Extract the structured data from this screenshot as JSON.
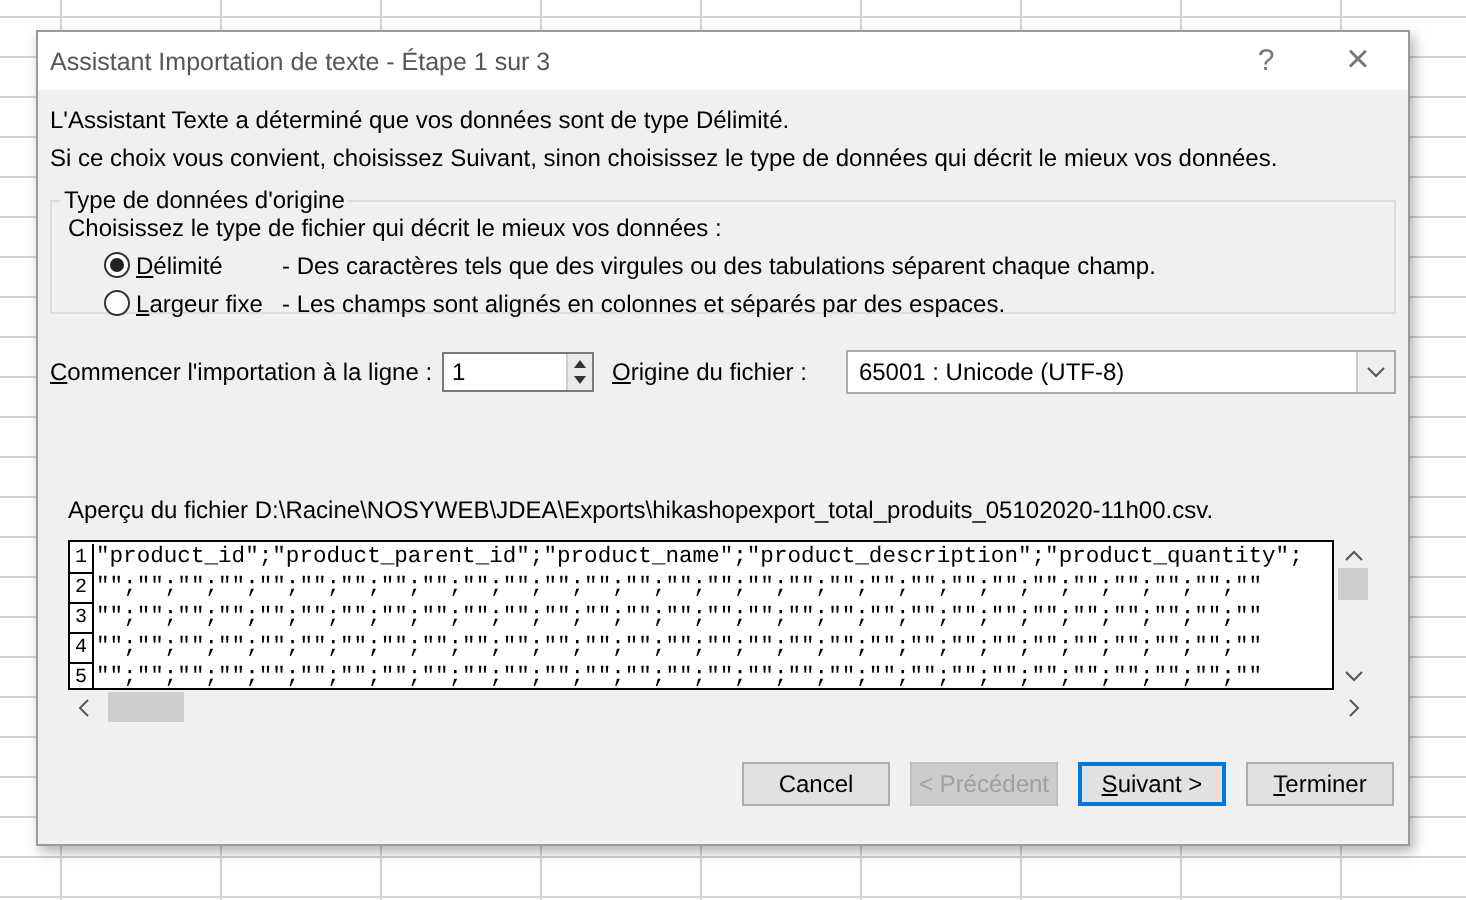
{
  "window": {
    "title": "Assistant Importation de texte - Étape 1 sur 3",
    "help": "?",
    "close": "×"
  },
  "intro": [
    "L'Assistant Texte a déterminé que vos données sont de type Délimité.",
    "Si ce choix vous convient, choisissez Suivant, sinon choisissez le type de données qui décrit le mieux vos données."
  ],
  "group": {
    "title": "Type de données d'origine",
    "prompt": "Choisissez le type de fichier qui décrit le mieux vos données :",
    "options": [
      {
        "label": "Délimité",
        "mnemonic": true,
        "description": "- Des caractères tels que des virgules ou des tabulations séparent chaque champ.",
        "selected": true
      },
      {
        "label": "Largeur fixe",
        "mnemonic": true,
        "description": "- Les champs sont alignés en colonnes et séparés par des espaces.",
        "selected": false
      }
    ]
  },
  "start_row": {
    "label": "Commencer l'importation à la ligne :",
    "mnemonic": true,
    "value": "1"
  },
  "file_origin": {
    "label": "Origine du fichier :",
    "mnemonic": true,
    "value": "65001 : Unicode (UTF-8)"
  },
  "preview": {
    "label": "Aperçu du fichier D:\\Racine\\NOSYWEB\\JDEA\\Exports\\hikashopexport_total_produits_05102020-11h00.csv.",
    "rows": [
      {
        "number": "1",
        "text": "\"product_id\";\"product_parent_id\";\"product_name\";\"product_description\";\"product_quantity\";"
      },
      {
        "number": "2",
        "text": "\"\";\"\";\"\";\"\";\"\";\"\";\"\";\"\";\"\";\"\";\"\";\"\";\"\";\"\";\"\";\"\";\"\";\"\";\"\";\"\";\"\";\"\";\"\";\"\";\"\";\"\";\"\";\"\";\"\""
      },
      {
        "number": "3",
        "text": "\"\";\"\";\"\";\"\";\"\";\"\";\"\";\"\";\"\";\"\";\"\";\"\";\"\";\"\";\"\";\"\";\"\";\"\";\"\";\"\";\"\";\"\";\"\";\"\";\"\";\"\";\"\";\"\";\"\""
      },
      {
        "number": "4",
        "text": "\"\";\"\";\"\";\"\";\"\";\"\";\"\";\"\";\"\";\"\";\"\";\"\";\"\";\"\";\"\";\"\";\"\";\"\";\"\";\"\";\"\";\"\";\"\";\"\";\"\";\"\";\"\";\"\";\"\""
      },
      {
        "number": "5",
        "text": "\"\";\"\";\"\";\"\";\"\";\"\";\"\";\"\";\"\";\"\";\"\";\"\";\"\";\"\";\"\";\"\";\"\";\"\";\"\";\"\";\"\";\"\";\"\";\"\";\"\";\"\";\"\";\"\";\"\""
      }
    ]
  },
  "buttons": [
    {
      "label": "Cancel",
      "mnemonic": false,
      "disabled": false,
      "default": false
    },
    {
      "label": "< Précédent",
      "mnemonic": false,
      "disabled": true,
      "default": false
    },
    {
      "label": "Suivant >",
      "mnemonic": true,
      "disabled": false,
      "default": true
    },
    {
      "label": "Terminer",
      "mnemonic": true,
      "disabled": false,
      "default": false
    }
  ]
}
